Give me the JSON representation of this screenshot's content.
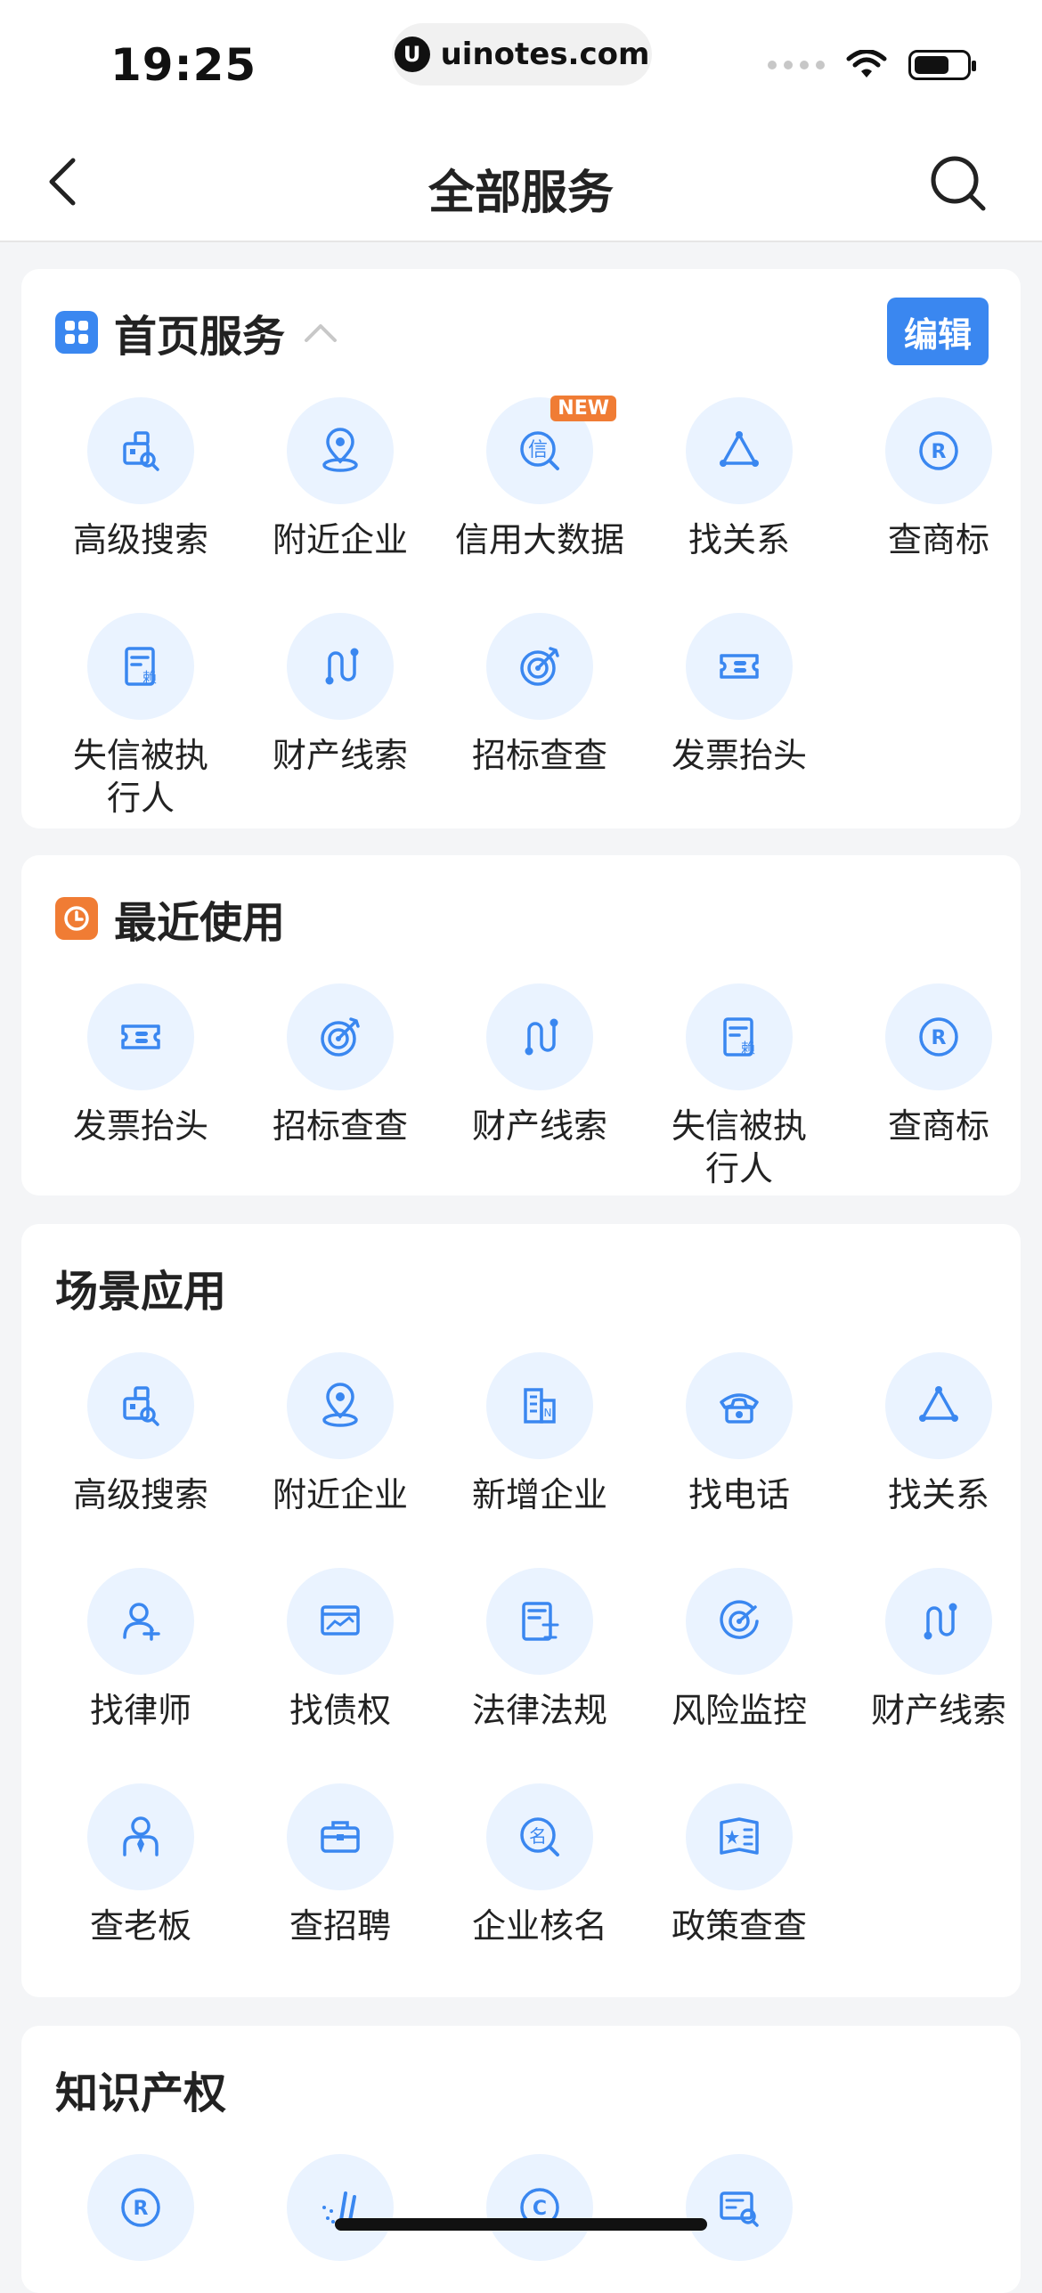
{
  "status_bar": {
    "time": "19:25",
    "url": "uinotes.com"
  },
  "nav": {
    "title": "全部服务"
  },
  "home_services": {
    "title": "首页服务",
    "edit_label": "编辑",
    "items": [
      {
        "label": "高级搜索",
        "icon": "advanced-search-icon"
      },
      {
        "label": "附近企业",
        "icon": "location-icon"
      },
      {
        "label": "信用大数据",
        "icon": "credit-data-icon",
        "tag": "NEW"
      },
      {
        "label": "找关系",
        "icon": "relationship-icon"
      },
      {
        "label": "查商标",
        "icon": "trademark-icon"
      },
      {
        "label": "失信被执\n行人",
        "icon": "dishonest-icon"
      },
      {
        "label": "财产线索",
        "icon": "asset-clue-icon"
      },
      {
        "label": "招标查查",
        "icon": "bidding-target-icon"
      },
      {
        "label": "发票抬头",
        "icon": "invoice-icon"
      }
    ]
  },
  "recent": {
    "title": "最近使用",
    "items": [
      {
        "label": "发票抬头",
        "icon": "invoice-icon"
      },
      {
        "label": "招标查查",
        "icon": "bidding-target-icon"
      },
      {
        "label": "财产线索",
        "icon": "asset-clue-icon"
      },
      {
        "label": "失信被执\n行人",
        "icon": "dishonest-icon"
      },
      {
        "label": "查商标",
        "icon": "trademark-icon"
      }
    ]
  },
  "scenes": {
    "title": "场景应用",
    "items": [
      {
        "label": "高级搜索",
        "icon": "advanced-search-icon"
      },
      {
        "label": "附近企业",
        "icon": "location-icon"
      },
      {
        "label": "新增企业",
        "icon": "new-company-icon"
      },
      {
        "label": "找电话",
        "icon": "phone-icon"
      },
      {
        "label": "找关系",
        "icon": "relationship-icon"
      },
      {
        "label": "找律师",
        "icon": "lawyer-icon"
      },
      {
        "label": "找债权",
        "icon": "creditor-icon"
      },
      {
        "label": "法律法规",
        "icon": "law-icon"
      },
      {
        "label": "风险监控",
        "icon": "risk-radar-icon"
      },
      {
        "label": "财产线索",
        "icon": "asset-clue-icon"
      },
      {
        "label": "查老板",
        "icon": "boss-icon"
      },
      {
        "label": "查招聘",
        "icon": "recruit-icon"
      },
      {
        "label": "企业核名",
        "icon": "name-check-icon"
      },
      {
        "label": "政策查查",
        "icon": "policy-icon"
      }
    ]
  },
  "ip": {
    "title": "知识产权",
    "items": [
      {
        "icon": "trademark-icon"
      },
      {
        "icon": "patent-icon"
      },
      {
        "icon": "copyright-icon"
      },
      {
        "icon": "certificate-search-icon"
      }
    ]
  },
  "colors": {
    "accent": "#3a87f0",
    "icon_bg": "#eaf3ff",
    "orange": "#f07c34"
  }
}
